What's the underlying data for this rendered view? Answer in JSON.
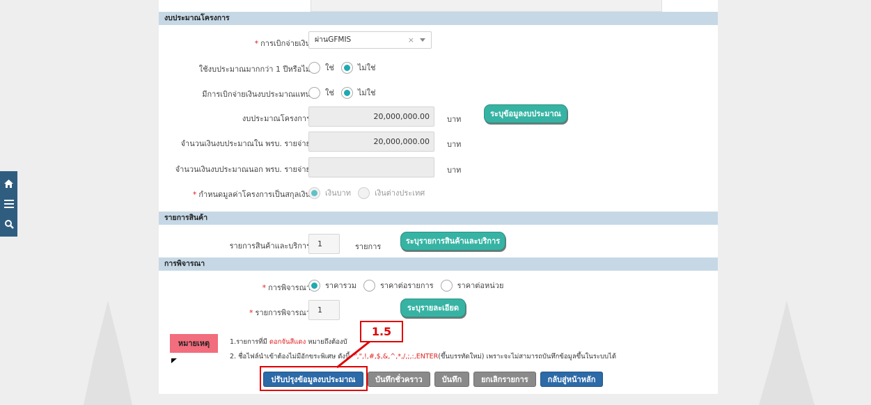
{
  "nav": {
    "home_icon": "home-icon",
    "menu_icon": "menu-icon",
    "search_icon": "search-icon"
  },
  "budget_section": {
    "title": "งบประมาณโครงการ",
    "disbursement_label": "การเบิกจ่ายเงิน",
    "disbursement_value": "ผ่านGFMIS",
    "clear_glyph": "×",
    "multi_year_label": "ใช้งบประมาณมากกว่า 1 ปีหรือไม่",
    "alt_disburse_label": "มีการเบิกจ่ายเงินงบประมาณแทน",
    "yes_label": "ใช่",
    "no_label": "ไม่ใช่",
    "project_budget_label": "งบประมาณโครงการ",
    "project_budget_value": "20,000,000.00",
    "in_act_label": "จำนวนเงินงบประมาณใน พรบ. รายจ่าย",
    "in_act_value": "20,000,000.00",
    "out_act_label": "จำนวนเงินงบประมาณนอก พรบ. รายจ่าย",
    "out_act_value": "",
    "baht_unit": "บาท",
    "specify_budget_button": "ระบุข้อมูลงบประมาณ",
    "currency_label": "กำหนดมูลค่าโครงการเป็นสกุลเงิน",
    "currency_thb": "เงินบาท",
    "currency_foreign": "เงินต่างประเทศ"
  },
  "items_section": {
    "title": "รายการสินค้า",
    "items_label": "รายการสินค้าและบริการ",
    "items_count": "1",
    "items_unit": "รายการ",
    "specify_items_button": "ระบุรายการสินค้าและบริการ"
  },
  "consider_section": {
    "title": "การพิจารณา",
    "method_label": "การพิจารณา",
    "opt_total": "ราคารวม",
    "opt_per_item": "ราคาต่อรายการ",
    "opt_per_unit": "ราคาต่อหน่วย",
    "items_label": "รายการพิจารณา",
    "items_count": "1",
    "detail_button": "ระบุรายละเอียด"
  },
  "note": {
    "badge": "หมายเหตุ",
    "line1_prefix": "1.รายการที่มี",
    "line1_red": "ดอกจันสีแดง",
    "line1_suffix": "หมายถึงต้องบั",
    "line2_prefix": "2. ชื่อไฟล์นำเข้าต้องไม่มีอักขระพิเศษ ดังนี้",
    "line2_red": "'\",\",!,#,$,&,^,*,/,;,:,ENTER",
    "line2_suffix": "(ขึ้นบรรทัดใหม่) เพราะจะไม่สามารถบันทึกข้อมูลขึ้นในระบบได้"
  },
  "actions": {
    "update_budget": "ปรับปรุงข้อมูลงบประมาณ",
    "save_draft": "บันทึกชั่วคราว",
    "save": "บันทึก",
    "cancel_item": "ยกเลิกรายการ",
    "back_home": "กลับสู่หน้าหลัก"
  },
  "callout": {
    "label": "1.5",
    "color": "#e00000"
  },
  "colors": {
    "header_bg": "#c6d8e5",
    "teal": "#37b3a4",
    "primary_blue": "#2c6aa8",
    "gray_button": "#8a8a8a",
    "note_pink": "#f26d7d"
  }
}
